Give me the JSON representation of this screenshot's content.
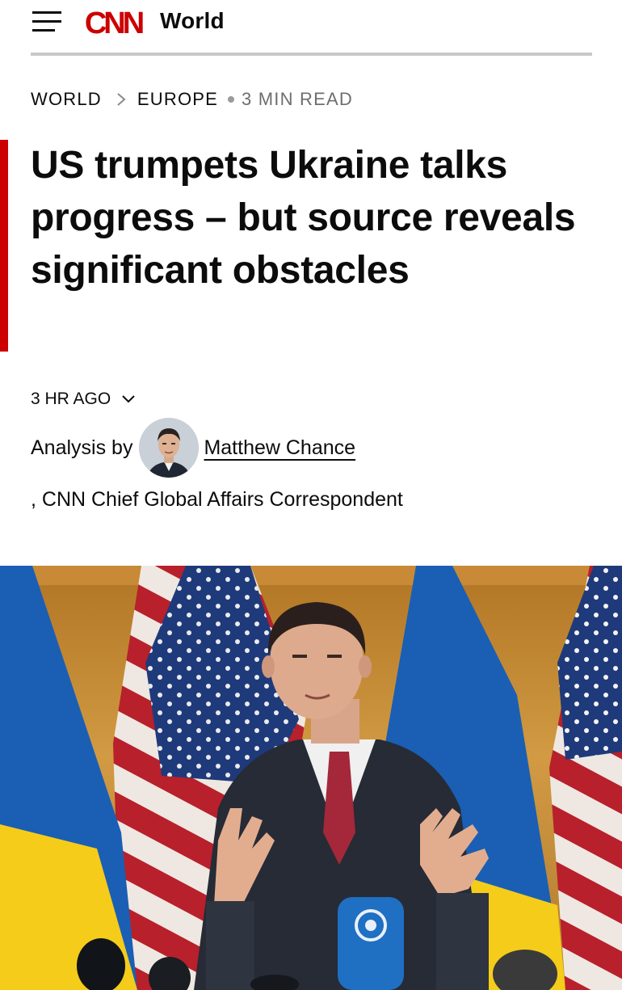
{
  "header": {
    "logo_text": "CNN",
    "section": "World",
    "icons": {
      "menu": "hamburger-menu-icon",
      "logo": "cnn-logo"
    },
    "colors": {
      "logo_red": "#cc0000"
    }
  },
  "breadcrumb": {
    "items": [
      "WORLD",
      "EUROPE"
    ],
    "separator_icon": "chevron-right-icon",
    "read_time": "3 MIN READ"
  },
  "article": {
    "headline": "US trumpets Ukraine talks progress – but source reveals significant obstacles",
    "accent_color": "#cc0000",
    "timestamp": "3 HR AGO",
    "timestamp_icon": "chevron-down-icon",
    "byline_prefix": "Analysis by",
    "author": "Matthew Chance",
    "author_role": ", CNN Chief Global Affairs Correspondent"
  },
  "photo": {
    "icons": [
      "us-flag",
      "ukraine-flag",
      "microphone-icon"
    ],
    "colors": {
      "ukraine_blue": "#1a5fb4",
      "ukraine_yellow": "#f5cc1a",
      "suit": "#262b36",
      "tie": "#a4283a"
    }
  }
}
